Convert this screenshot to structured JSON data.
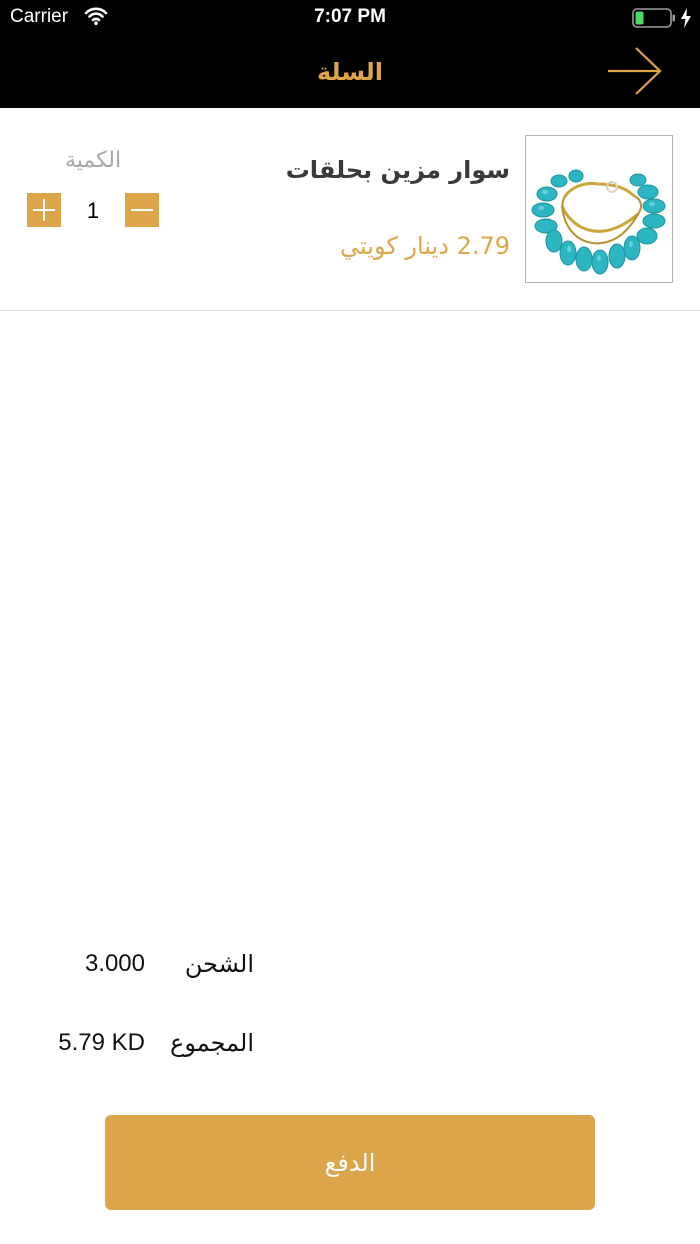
{
  "status_bar": {
    "carrier": "Carrier",
    "time": "7:07 PM"
  },
  "header": {
    "title": "السلة",
    "back_icon": "arrow-right-icon"
  },
  "cart": {
    "items": [
      {
        "name": "سوار مزين بحلقات",
        "price": "2.79 دينار كويتي",
        "quantity_label": "الكمية",
        "quantity": "1"
      }
    ]
  },
  "summary": {
    "shipping_label": "الشحن",
    "shipping_value": "3.000",
    "total_label": "المجموع",
    "total_value": "5.79 KD"
  },
  "checkout": {
    "pay_label": "الدفع"
  },
  "colors": {
    "accent": "#dda54a",
    "header_bg": "#000000",
    "battery": "#4cd964"
  }
}
